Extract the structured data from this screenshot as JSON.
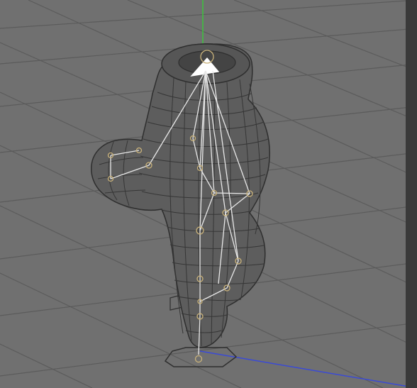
{
  "viewport": {
    "background": "#6f6f6f",
    "grid_color": "#5a5a5a",
    "mesh_fill": "#5c5c5c",
    "mesh_line": "#3b3b3b",
    "bone_color": "#e6e6e6",
    "joint_color": "#c9b27a",
    "axis_y_color": "#39c439",
    "axis_x_color": "#3b4bd8",
    "handle_color": "#ffffff"
  },
  "tools": {
    "selection": "rig-root-joint",
    "gizmo": "move-gizmo-icon"
  }
}
